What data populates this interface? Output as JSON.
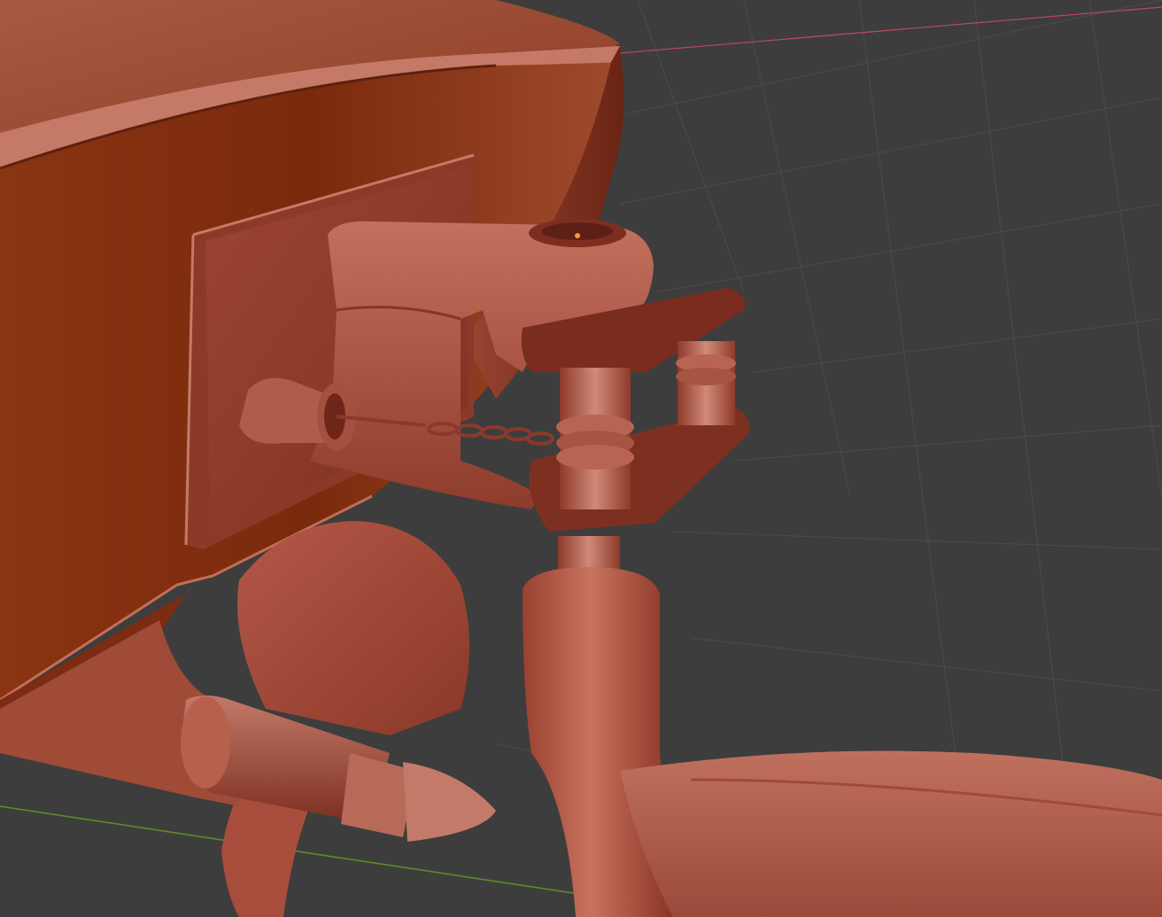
{
  "viewport": {
    "background": "#3d3d3d",
    "grid_line_color": "#4a4a4a",
    "x_axis_color": "#b44a5a",
    "y_axis_color": "#5f8a2a",
    "origin_marker_color": "#f0a030"
  },
  "model": {
    "material_color": "#b5574a",
    "shadow_color": "#5a1c0e",
    "highlight_color": "#d98a7c",
    "parts": [
      "hull",
      "transom-plate",
      "tiller-bracket",
      "rudder-pin",
      "hinge-springs",
      "chain",
      "cleat",
      "propeller",
      "propeller-shaft",
      "prop-cone",
      "rudder-post",
      "rudder-blade"
    ]
  }
}
